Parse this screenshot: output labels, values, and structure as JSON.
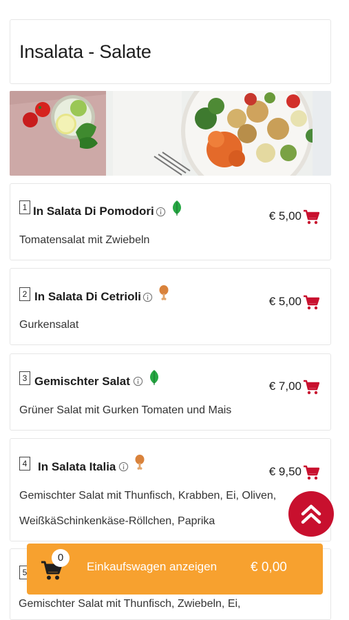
{
  "category": {
    "title": "Insalata - Salate"
  },
  "banner": {
    "alt": ""
  },
  "colors": {
    "accent": "#c8102e",
    "cart_bar": "#f7a12f",
    "veg": "#27a844",
    "nonveg": "#d9823b"
  },
  "items": [
    {
      "number": "1",
      "name": "In Salata Di Pomodori",
      "diet_icon": "leaf-icon",
      "price": "€ 5,00",
      "description": "Tomatensalat mit Zwiebeln"
    },
    {
      "number": "2",
      "name": "In Salata Di Cetrioli",
      "diet_icon": "drumstick-icon",
      "price": "€ 5,00",
      "description": "Gurkensalat"
    },
    {
      "number": "3",
      "name": "Gemischter Salat",
      "diet_icon": "leaf-icon",
      "price": "€ 7,00",
      "description": "Grüner Salat mit Gurken Tomaten und Mais"
    },
    {
      "number": "4",
      "name": "In Salata Italia",
      "diet_icon": "drumstick-icon",
      "price": "€ 9,50",
      "description_line1": "Gemischter Salat mit Thunfisch, Krabben, Ei, Oliven,",
      "description_line2": "WeißkäSchinkenkäse-Röllchen, Paprika"
    },
    {
      "number": "5",
      "description_partial": "Gemischter Salat mit Thunfisch, Zwiebeln, Ei,"
    }
  ],
  "cart": {
    "count": "0",
    "label": "Einkaufswagen anzeigen",
    "total": "€ 0,00"
  }
}
